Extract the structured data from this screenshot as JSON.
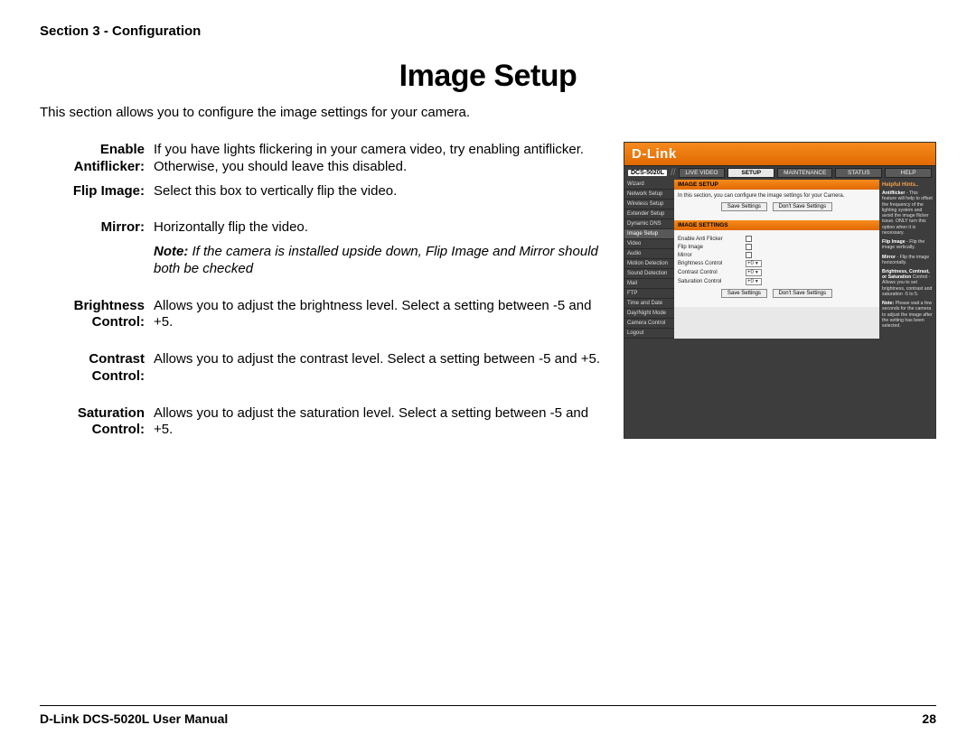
{
  "header": {
    "section": "Section 3 - Configuration"
  },
  "title": "Image Setup",
  "intro": "This section allows you to configure the image settings for your camera.",
  "defs": {
    "antiflicker": {
      "label": "Enable Antiflicker:",
      "desc": "If you have lights flickering in your camera video, try enabling antiflicker. Otherwise, you should leave this disabled."
    },
    "flip": {
      "label": "Flip Image:",
      "desc": "Select this box to vertically flip the video."
    },
    "mirror": {
      "label": "Mirror:",
      "desc": "Horizontally flip the video."
    },
    "note": {
      "lead": "Note:",
      "desc": " If the camera is installed upside down, Flip Image and Mirror should both be checked"
    },
    "brightness": {
      "label": "Brightness Control:",
      "desc": "Allows you to adjust the brightness level. Select a setting between -5 and +5."
    },
    "contrast": {
      "label": "Contrast Control:",
      "desc": "Allows you to adjust the contrast level. Select a setting between -5 and +5."
    },
    "saturation": {
      "label": "Saturation Control:",
      "desc": "Allows you to adjust the saturation level. Select a setting between -5 and +5."
    }
  },
  "mini": {
    "brand": "D-Link",
    "model": "DCS-5020L",
    "tabs": [
      "LIVE VIDEO",
      "SETUP",
      "MAINTENANCE",
      "STATUS",
      "HELP"
    ],
    "active_tab": "SETUP",
    "sidebar": [
      "Wizard",
      "Network Setup",
      "Wireless Setup",
      "Extender Setup",
      "Dynamic DNS",
      "Image Setup",
      "Video",
      "Audio",
      "Motion Detection",
      "Sound Detection",
      "Mail",
      "FTP",
      "Time and Date",
      "Day/Night Mode",
      "Camera Control",
      "Logout"
    ],
    "active_sidebar": "Image Setup",
    "panel": {
      "title": "IMAGE SETUP",
      "subtitle": "In this section, you can configure the image settings for your Camera.",
      "save": "Save Settings",
      "dont_save": "Don't Save Settings",
      "settings_title": "IMAGE SETTINGS",
      "rows": {
        "antiflicker": "Enable Anti Flicker",
        "flip": "Flip Image",
        "mirror": "Mirror",
        "brightness": "Brightness Control",
        "contrast": "Contrast Control",
        "saturation": "Saturation Control"
      },
      "values": {
        "brightness": "+0",
        "contrast": "+0",
        "saturation": "+0"
      }
    },
    "hints": {
      "title": "Helpful Hints..",
      "p1_b": "Antiflicker",
      "p1": " - This feature will help to offset the frequency of the lighting system and avoid the image flicker issue. ONLY turn this option when it is necessary.",
      "p2_b": "Flip Image",
      "p2": " - Flip the image vertically.",
      "p3_b": "Mirror",
      "p3": " - Flip the image horizontally.",
      "p4_b": "Brightness, Contrast, or Saturation",
      "p4": " Control - Allows you to set brightness, contrast and saturation -5 to 5.",
      "p5_b": "Note:",
      "p5": " Please wait a few seconds for the camera to adjust the image after the setting has been selected."
    }
  },
  "footer": {
    "manual": "D-Link DCS-5020L User Manual",
    "page": "28"
  }
}
